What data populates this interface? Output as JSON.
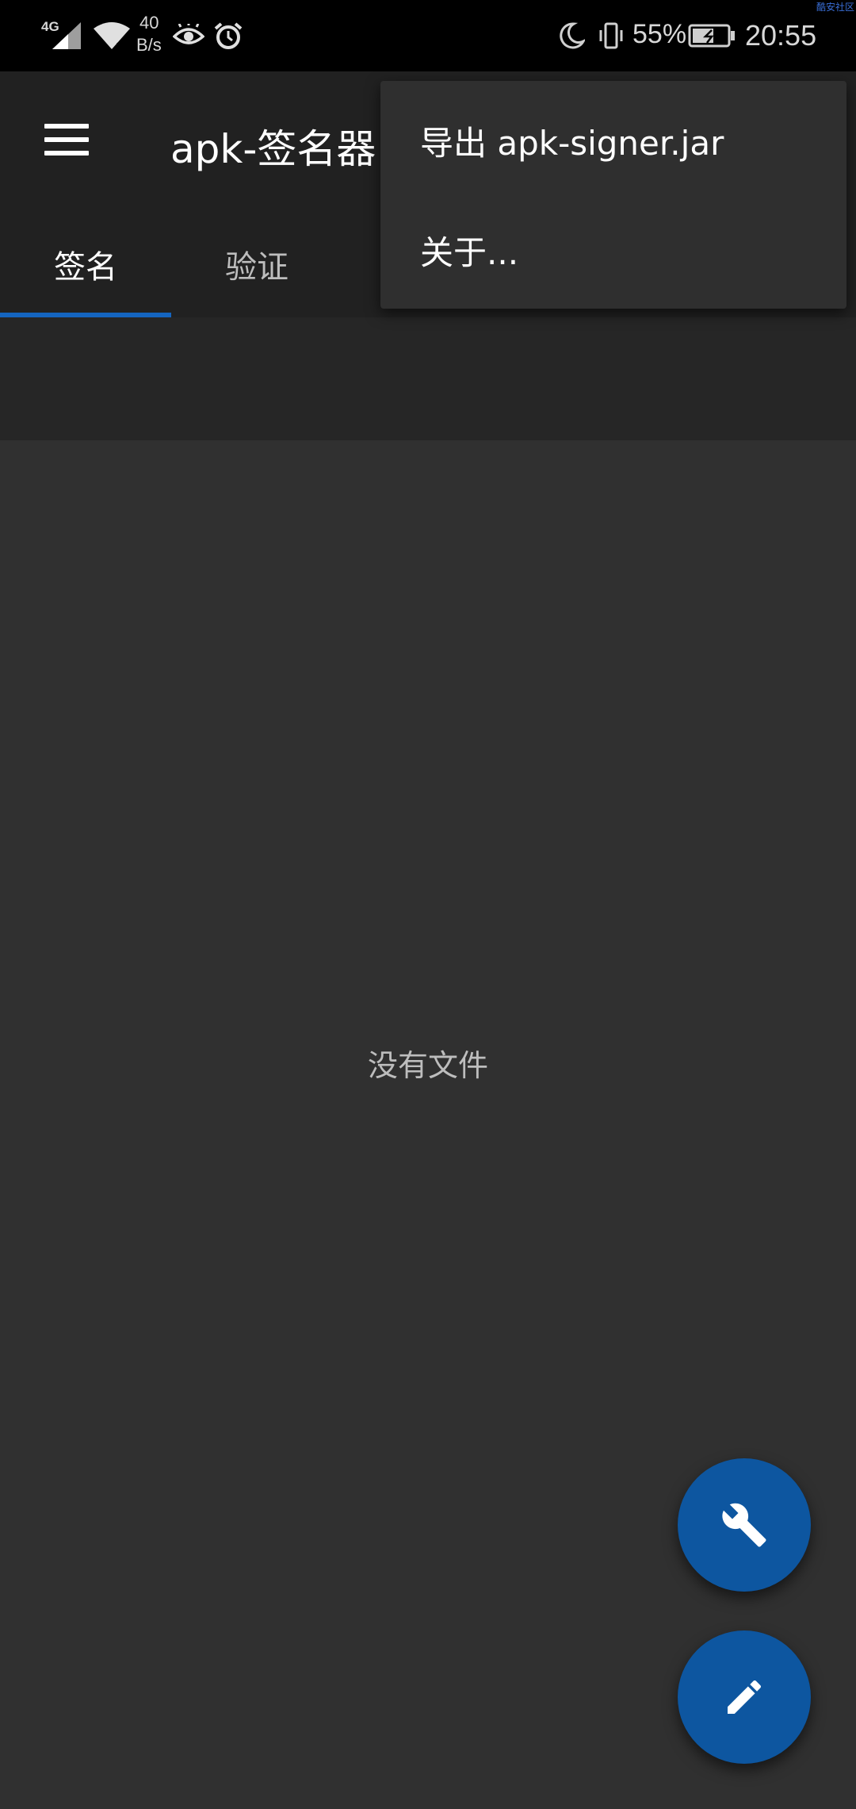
{
  "status_bar": {
    "network": "4G",
    "speed_value": "40",
    "speed_unit": "B/s",
    "battery": "55%",
    "time": "20:55",
    "icons": [
      "signal-icon",
      "wifi-icon",
      "eye-icon",
      "alarm-icon",
      "moon-icon",
      "vibrate-icon",
      "battery-icon"
    ]
  },
  "watermark": "酷安社区",
  "app_bar": {
    "title": "apk-签名器",
    "menu_icon": "hamburger-menu-icon"
  },
  "tabs": [
    {
      "label": "签名",
      "selected": true
    },
    {
      "label": "验证",
      "selected": false
    }
  ],
  "main": {
    "empty_text": "没有文件"
  },
  "overflow_menu": {
    "items": [
      {
        "label": "导出 apk-signer.jar"
      },
      {
        "label": "关于..."
      }
    ]
  },
  "fabs": [
    {
      "icon": "wrench-icon"
    },
    {
      "icon": "pencil-icon"
    }
  ],
  "colors": {
    "accent": "#1565c0",
    "fab": "#0d56a0",
    "app_bar": "#212121",
    "background": "#303030",
    "menu": "#2f2f2f"
  }
}
